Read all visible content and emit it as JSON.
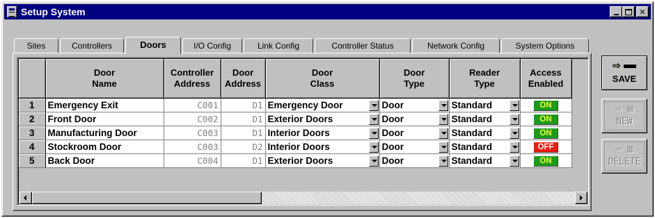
{
  "window": {
    "title": "Setup System"
  },
  "tabs": [
    {
      "label": "Sites",
      "active": false
    },
    {
      "label": "Controllers",
      "active": false
    },
    {
      "label": "Doors",
      "active": true
    },
    {
      "label": "I/O Config",
      "active": false
    },
    {
      "label": "Link Config",
      "active": false
    },
    {
      "label": "Controller Status",
      "active": false
    },
    {
      "label": "Network Config",
      "active": false
    },
    {
      "label": "System Options",
      "active": false
    }
  ],
  "grid": {
    "columns": [
      {
        "line1": "Door",
        "line2": "Name"
      },
      {
        "line1": "Controller",
        "line2": "Address"
      },
      {
        "line1": "Door",
        "line2": "Address"
      },
      {
        "line1": "Door",
        "line2": "Class"
      },
      {
        "line1": "Door",
        "line2": "Type"
      },
      {
        "line1": "Reader",
        "line2": "Type"
      },
      {
        "line1": "Access",
        "line2": "Enabled"
      }
    ],
    "rows": [
      {
        "num": "1",
        "name": "Emergency Exit",
        "controller_address": "C001",
        "door_address": "D1",
        "door_class": "Emergency Door",
        "door_type": "Door",
        "reader_type": "Standard",
        "access": "ON",
        "access_state": "on"
      },
      {
        "num": "2",
        "name": "Front Door",
        "controller_address": "C002",
        "door_address": "D1",
        "door_class": "Exterior Doors",
        "door_type": "Door",
        "reader_type": "Standard",
        "access": "ON",
        "access_state": "on"
      },
      {
        "num": "3",
        "name": "Manufacturing Door",
        "controller_address": "C003",
        "door_address": "D1",
        "door_class": "Interior Doors",
        "door_type": "Door",
        "reader_type": "Standard",
        "access": "ON",
        "access_state": "on"
      },
      {
        "num": "4",
        "name": "Stockroom Door",
        "controller_address": "C003",
        "door_address": "D2",
        "door_class": "Interior Doors",
        "door_type": "Door",
        "reader_type": "Standard",
        "access": "OFF",
        "access_state": "off"
      },
      {
        "num": "5",
        "name": "Back Door",
        "controller_address": "C004",
        "door_address": "D1",
        "door_class": "Exterior Doors",
        "door_type": "Door",
        "reader_type": "Standard",
        "access": "ON",
        "access_state": "on"
      }
    ]
  },
  "buttons": {
    "save": {
      "label": "SAVE",
      "icon": "arrow-save-icon",
      "enabled": true
    },
    "new": {
      "label": "NEW",
      "icon": "arrow-new-record-icon",
      "enabled": false
    },
    "delete": {
      "label": "DELETE",
      "icon": "arrow-trash-icon",
      "enabled": false
    }
  },
  "colors": {
    "titlebar": "#000080",
    "on": "#1c9a1c",
    "off": "#e81c10",
    "face": "#c0c0c0"
  }
}
